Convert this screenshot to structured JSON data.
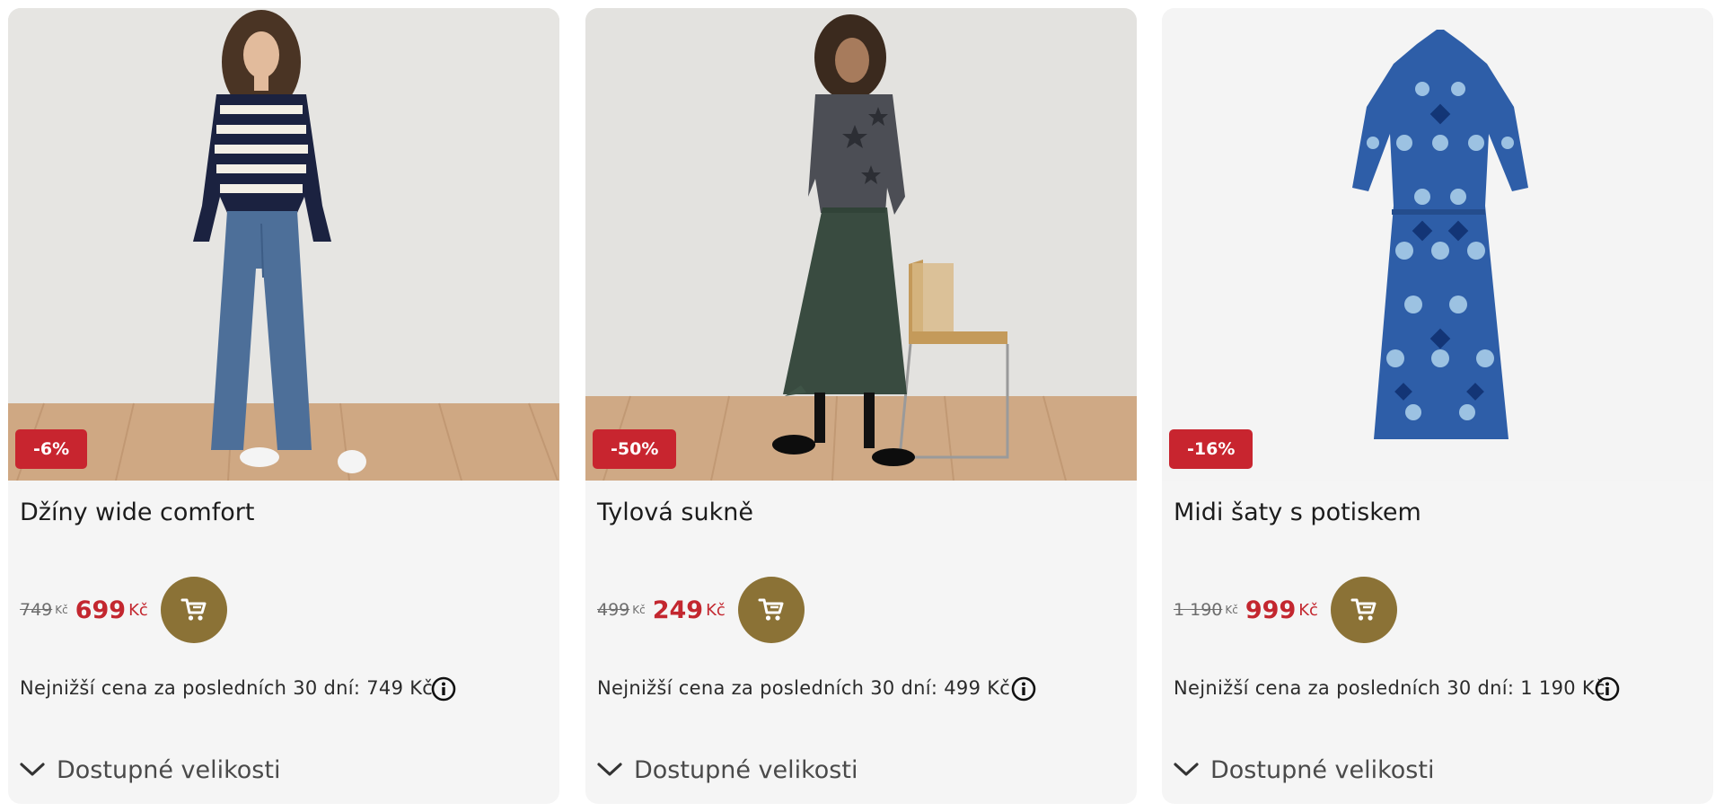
{
  "products": [
    {
      "badge": "-6%",
      "title": "Džíny wide comfort",
      "old_price": "749",
      "old_currency": "Kč",
      "new_price": "699",
      "new_currency": "Kč",
      "lowest_price_text": "Nejnižší cena za posledních 30 dní: 749 Kč",
      "sizes_label": "Dostupné velikosti"
    },
    {
      "badge": "-50%",
      "title": "Tylová sukně",
      "old_price": "499",
      "old_currency": "Kč",
      "new_price": "249",
      "new_currency": "Kč",
      "lowest_price_text": "Nejnižší cena za posledních 30 dní: 499 Kč",
      "sizes_label": "Dostupné velikosti"
    },
    {
      "badge": "-16%",
      "title": "Midi šaty s potiskem",
      "old_price": "1 190",
      "old_currency": "Kč",
      "new_price": "999",
      "new_currency": "Kč",
      "lowest_price_text": "Nejnižší cena za posledních 30 dní: 1 190 Kč",
      "sizes_label": "Dostupné velikosti"
    }
  ],
  "icons": {
    "cart": "cart-icon",
    "info": "info-icon",
    "chevron": "chevron-down-icon"
  },
  "colors": {
    "discount_badge": "#c8252f",
    "sale_price": "#c3272f",
    "cart_button": "#8b7236",
    "card_background": "#f5f5f5"
  }
}
